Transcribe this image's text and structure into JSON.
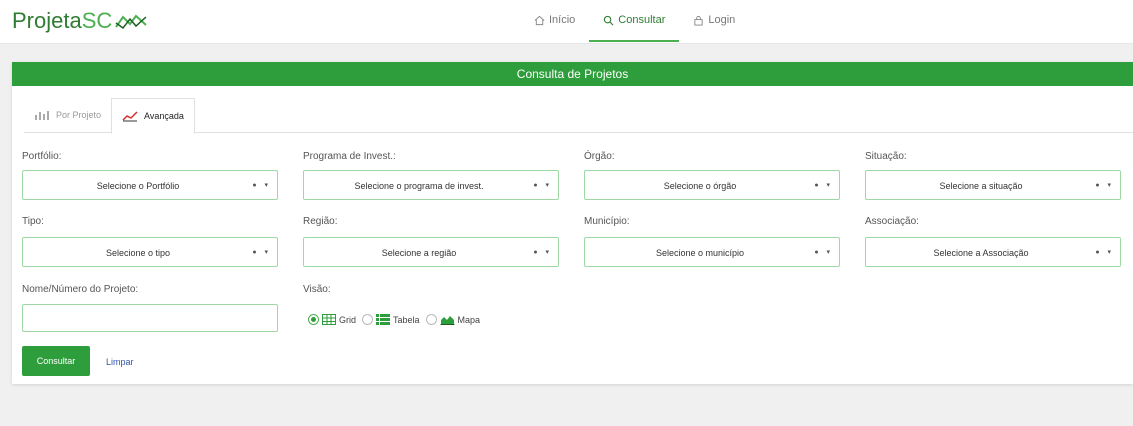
{
  "brand": {
    "part1": "Projeta",
    "part2": "SC"
  },
  "nav": [
    {
      "label": "Início",
      "icon": "home-icon"
    },
    {
      "label": "Consultar",
      "icon": "search-icon"
    },
    {
      "label": "Login",
      "icon": "lock-icon"
    }
  ],
  "card": {
    "title": "Consulta de Projetos"
  },
  "tabs": [
    {
      "label": "Por Projeto",
      "icon": "bar-chart-icon"
    },
    {
      "label": "Avançada",
      "icon": "line-chart-icon"
    }
  ],
  "filters": {
    "portfolio": {
      "label": "Portfólio:",
      "value": "Selecione o Portfólio"
    },
    "programa": {
      "label": "Programa de Invest.:",
      "value": "Selecione o programa de invest."
    },
    "orgao": {
      "label": "Órgão:",
      "value": "Selecione o órgão"
    },
    "situacao": {
      "label": "Situação:",
      "value": "Selecione a situação"
    },
    "tipo": {
      "label": "Tipo:",
      "value": "Selecione o tipo"
    },
    "regiao": {
      "label": "Região:",
      "value": "Selecione a região"
    },
    "municipio": {
      "label": "Município:",
      "value": "Selecione o município"
    },
    "associacao": {
      "label": "Associação:",
      "value": "Selecione a Associação"
    }
  },
  "nome": {
    "label": "Nome/Número do Projeto:",
    "value": ""
  },
  "visao": {
    "label": "Visão:",
    "options": [
      {
        "label": "Grid",
        "icon": "grid-icon",
        "checked": true
      },
      {
        "label": "Tabela",
        "icon": "list-icon",
        "checked": false
      },
      {
        "label": "Mapa",
        "icon": "area-chart-icon",
        "checked": false
      }
    ]
  },
  "actions": {
    "submit": "Consultar",
    "clear": "Limpar"
  },
  "colors": {
    "primary": "#2e9e3c",
    "accent": "#4caf50",
    "link": "#3355aa"
  }
}
